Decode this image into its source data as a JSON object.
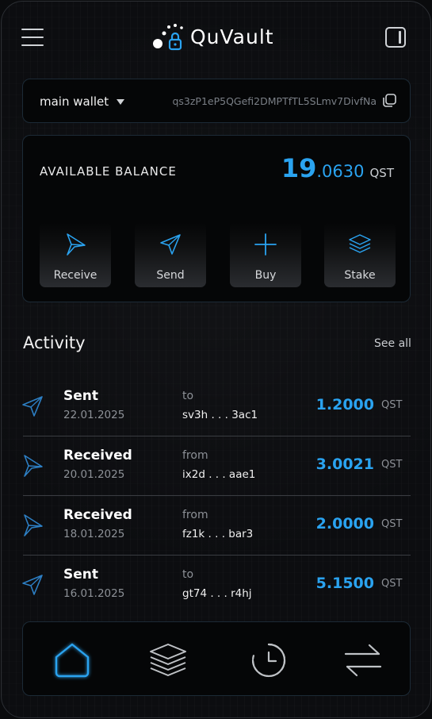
{
  "app": {
    "name": "QuVault"
  },
  "wallet": {
    "name": "main wallet",
    "address": "qs3zP1eP5QGefi2DMPTfTL5SLmv7DivfNa"
  },
  "balance": {
    "label": "AVAILABLE BALANCE",
    "integer": "19",
    "fraction": ".0630",
    "unit": "QST"
  },
  "actions": [
    {
      "label": "Receive",
      "icon": "receive-icon"
    },
    {
      "label": "Send",
      "icon": "send-icon"
    },
    {
      "label": "Buy",
      "icon": "plus-icon"
    },
    {
      "label": "Stake",
      "icon": "layers-icon"
    }
  ],
  "activity": {
    "title": "Activity",
    "see_all": "See all",
    "items": [
      {
        "type": "Sent",
        "date": "22.01.2025",
        "direction": "to",
        "address": "sv3h . . . 3ac1",
        "amount": "1.2000",
        "unit": "QST",
        "icon": "sent-arrow-icon"
      },
      {
        "type": "Received",
        "date": "20.01.2025",
        "direction": "from",
        "address": "ix2d . . . aae1",
        "amount": "3.0021",
        "unit": "QST",
        "icon": "received-arrow-icon"
      },
      {
        "type": "Received",
        "date": "18.01.2025",
        "direction": "from",
        "address": "fz1k . . . bar3",
        "amount": "2.0000",
        "unit": "QST",
        "icon": "received-arrow-icon"
      },
      {
        "type": "Sent",
        "date": "16.01.2025",
        "direction": "to",
        "address": "gt74 . . . r4hj",
        "amount": "5.1500",
        "unit": "QST",
        "icon": "sent-arrow-icon"
      }
    ]
  },
  "nav": [
    {
      "icon": "home-icon",
      "active": true
    },
    {
      "icon": "layers-icon",
      "active": false
    },
    {
      "icon": "history-icon",
      "active": false
    },
    {
      "icon": "swap-icon",
      "active": false
    }
  ],
  "colors": {
    "accent": "#2aa3f0",
    "background": "#0c0d10",
    "card": "#050607",
    "muted": "#8d9197"
  }
}
